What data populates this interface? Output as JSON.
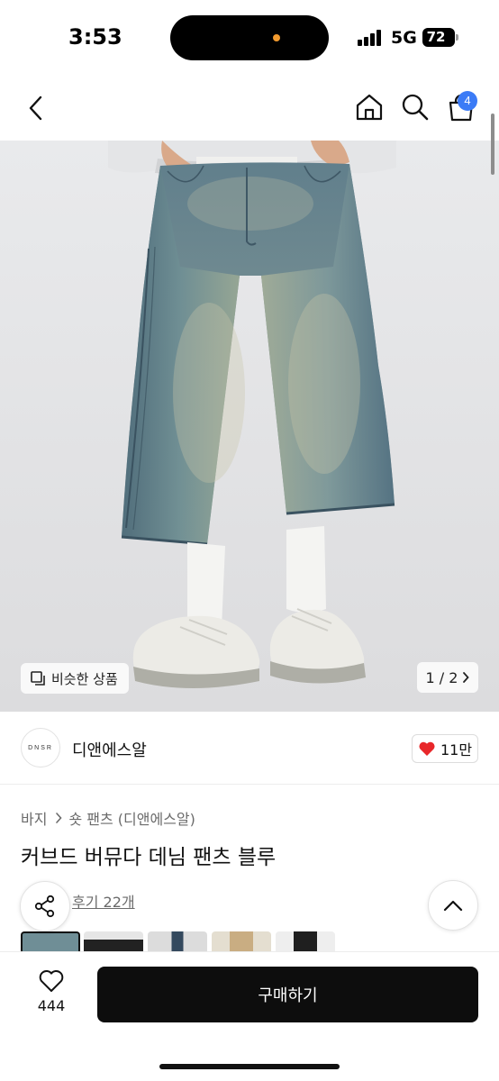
{
  "status_bar": {
    "time": "3:53",
    "network": "5G",
    "battery": "72"
  },
  "header": {
    "back_icon": "chevron-left-icon",
    "home_icon": "home-icon",
    "search_icon": "search-icon",
    "cart_icon": "shopping-bag-icon",
    "cart_badge": "4",
    "badge_color": "#3b7bf6"
  },
  "gallery": {
    "similar_label": "비슷한 상품",
    "pager": "1 / 2"
  },
  "brand": {
    "logo_text": "DNSR",
    "name": "디앤에스알",
    "likes": "11만",
    "heart_color": "#e8272a"
  },
  "product": {
    "breadcrumb": [
      "바지",
      "숏 팬츠 (디앤에스알)"
    ],
    "title": "커브드 버뮤다 데님 팬츠 블루",
    "review_link": "후기 22개"
  },
  "bottom_bar": {
    "wish_count": "444",
    "buy_label": "구매하기",
    "buy_color": "#0d0d0d"
  }
}
